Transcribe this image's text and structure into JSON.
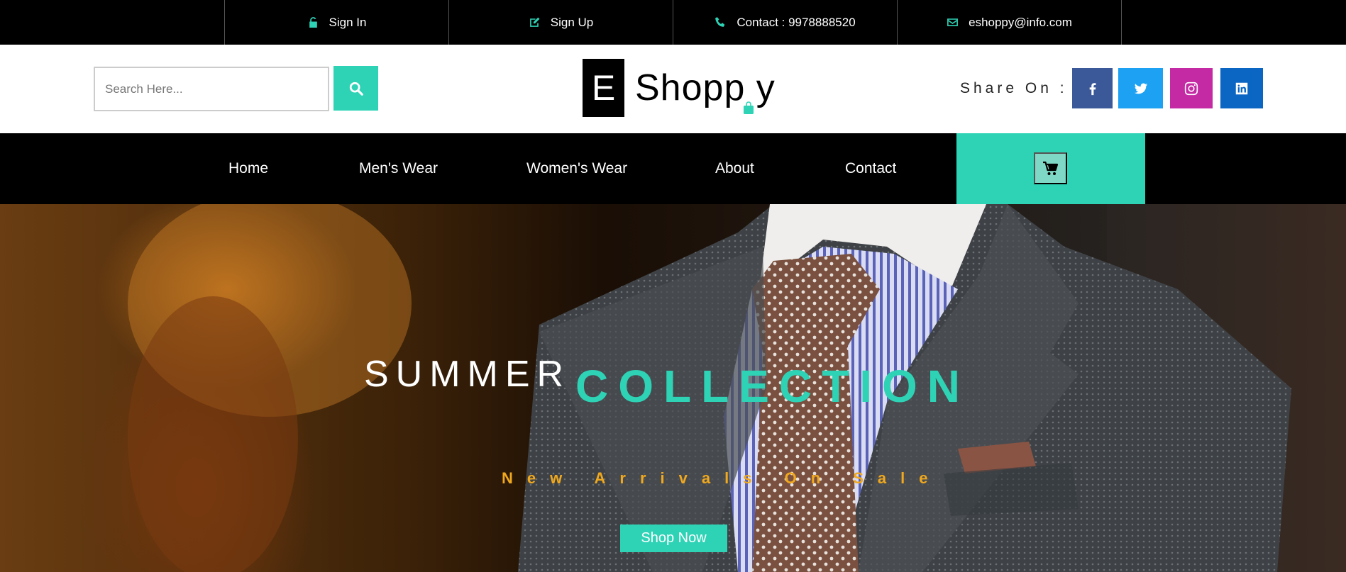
{
  "topbar": {
    "items": [
      {
        "label": "Sign In",
        "icon": "lock-icon"
      },
      {
        "label": "Sign Up",
        "icon": "edit-icon"
      },
      {
        "label": "Contact : 9978888520",
        "icon": "phone-icon"
      },
      {
        "label": "eshoppy@info.com",
        "icon": "envelope-icon"
      }
    ]
  },
  "header": {
    "search": {
      "placeholder": "Search Here...",
      "value": ""
    },
    "logo": {
      "letter": "E",
      "text": "Shopp y"
    },
    "share_label": "Share On :",
    "social": [
      {
        "name": "facebook",
        "color": "#3b5998"
      },
      {
        "name": "twitter",
        "color": "#1da1f2"
      },
      {
        "name": "instagram",
        "color": "#c32aa3"
      },
      {
        "name": "linkedin",
        "color": "#0a66c2"
      }
    ]
  },
  "nav": {
    "items": [
      {
        "label": "Home"
      },
      {
        "label": "Men's Wear"
      },
      {
        "label": "Women's Wear"
      },
      {
        "label": "About"
      },
      {
        "label": "Contact"
      }
    ]
  },
  "hero": {
    "title_part1": "SUMMER",
    "title_part2": "COLLECTION",
    "subtitle": "New Arrivals On Sale",
    "button": "Shop Now"
  },
  "colors": {
    "accent": "#2ed3b6",
    "subtitle": "#f0a81e",
    "dark": "#000000"
  }
}
